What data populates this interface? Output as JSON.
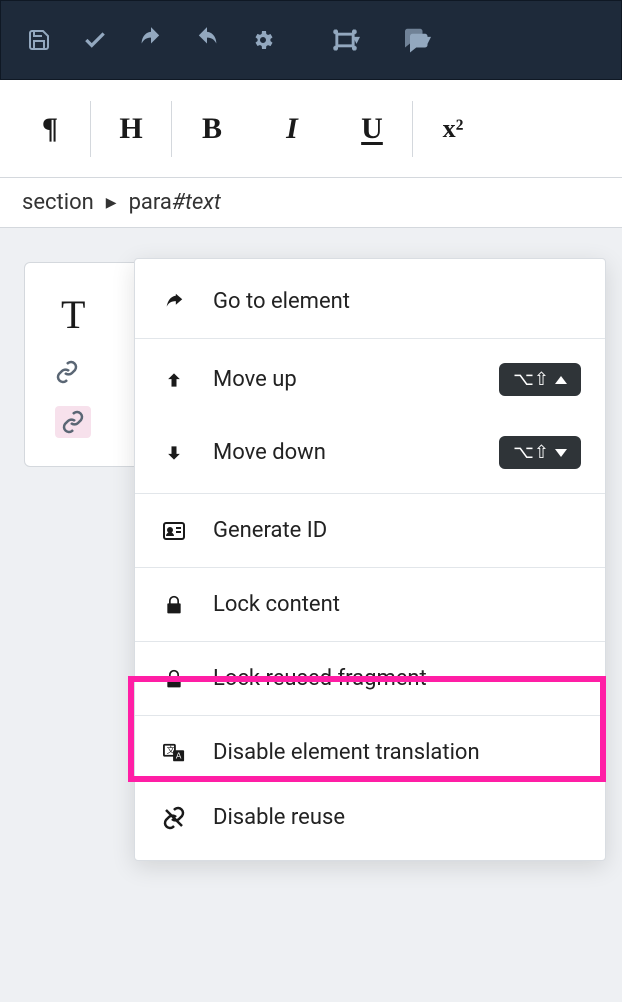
{
  "topbar": {
    "icons": {
      "save": "save-icon",
      "check": "check-icon",
      "undo": "undo-icon",
      "redo": "redo-icon",
      "settings": "gear-icon",
      "fullscreen": "fullscreen-icon",
      "comments": "comments-icon"
    }
  },
  "formatbar": {
    "pilcrow": "¶",
    "heading": "H",
    "bold": "B",
    "italic": "I",
    "underline": "U",
    "superscript": "x²"
  },
  "breadcrumb": {
    "first": "section",
    "second_base": "para",
    "second_suffix": "#text"
  },
  "card": {
    "title_fragment": "T"
  },
  "context_menu": {
    "goto": "Go to element",
    "move_up": "Move up",
    "move_up_shortcut": "⌥⇧",
    "move_down": "Move down",
    "move_down_shortcut": "⌥⇧",
    "generate_id": "Generate ID",
    "lock_content": "Lock content",
    "lock_reused_fragment": "Lock reused fragment",
    "disable_translation": "Disable element translation",
    "disable_reuse": "Disable reuse"
  }
}
